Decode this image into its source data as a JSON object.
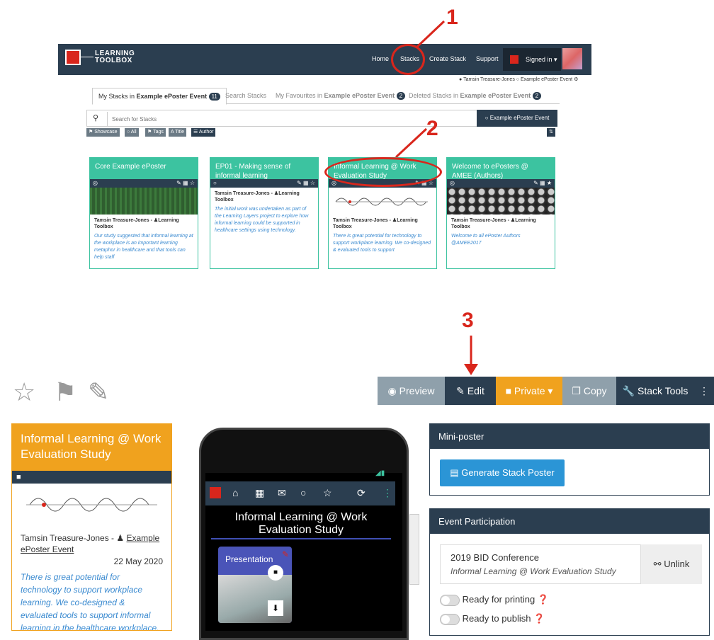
{
  "annotations": {
    "one": "1",
    "two": "2",
    "three": "3"
  },
  "top": {
    "logo_line1": "LEARNING",
    "logo_line2": "TOOLBOX",
    "nav": {
      "home": "Home",
      "stacks": "Stacks",
      "create": "Create Stack",
      "support": "Support",
      "signed": "Signed in ▾"
    },
    "user_line": "Tamsin Treasure-Jones",
    "event_line": "Example ePoster Event",
    "tabs": [
      {
        "label": "My Stacks in ",
        "bold": "Example ePoster Event",
        "count": "11"
      },
      {
        "label": "Search Stacks"
      },
      {
        "label": "My Favourites in ",
        "bold": "Example ePoster Event",
        "count": "2"
      },
      {
        "label": "Deleted Stacks in ",
        "bold": "Example ePoster Event",
        "count": "2"
      }
    ],
    "search_placeholder": "Search for Stacks",
    "event_button": "Example ePoster Event",
    "filters": {
      "showcase": "Showcase",
      "all": "All",
      "tags": "Tags",
      "title": "Title",
      "author": "Author"
    },
    "cards": [
      {
        "title": "Core Example ePoster",
        "author": "Tamsin Treasure-Jones - ",
        "org": "Learning Toolbox",
        "desc": "Our study suggested that informal learning at the workplace is an important learning metaphor in healthcare and that tools can help staff"
      },
      {
        "title": "EP01 - Making sense of informal learning",
        "author": "Tamsin Treasure-Jones - ",
        "org": "Learning Toolbox",
        "desc": "The initial work was undertaken as part of the Learning Layers project to explore how informal learning could be supported in healthcare settings using technology."
      },
      {
        "title": "Informal Learning @ Work Evaluation Study",
        "author": "Tamsin Treasure-Jones - ",
        "org": "Learning Toolbox",
        "desc": "There is great potential for technology to support workplace learning. We co-designed & evaluated tools to support"
      },
      {
        "title": "Welcome to ePosters @ AMEE (Authors)",
        "author": "Tamsin Treasure-Jones - ",
        "org": "Learning Toolbox",
        "desc": "Welcome to all ePoster Authors @AMEE2017"
      }
    ]
  },
  "bottom": {
    "toolbar": {
      "preview": "Preview",
      "edit": "Edit",
      "private": "Private ▾",
      "copy": "Copy",
      "stack_tools": "Stack Tools"
    },
    "card": {
      "title": "Informal Learning @ Work Evaluation Study",
      "author": "Tamsin Treasure-Jones - ",
      "event": "Example ePoster Event",
      "date": "22 May 2020",
      "desc": "There is great potential for technology to support workplace learning. We co-designed & evaluated tools to support informal learning in the healthcare workplace."
    },
    "phone": {
      "title": "Informal Learning @ Work Evaluation Study",
      "tile": "Presentation"
    },
    "mini_poster": {
      "heading": "Mini-poster",
      "button": "Generate Stack Poster"
    },
    "event": {
      "heading": "Event Participation",
      "conference": "2019 BID Conference",
      "stack": "Informal Learning @ Work Evaluation Study",
      "unlink": "Unlink",
      "ready_print": "Ready for printing",
      "ready_publish": "Ready to publish"
    }
  },
  "colors": {
    "teal": "#3cc3a0",
    "navy": "#2b3e50",
    "orange": "#f0a21e",
    "red": "#d9261c",
    "blue": "#2b95d6"
  }
}
